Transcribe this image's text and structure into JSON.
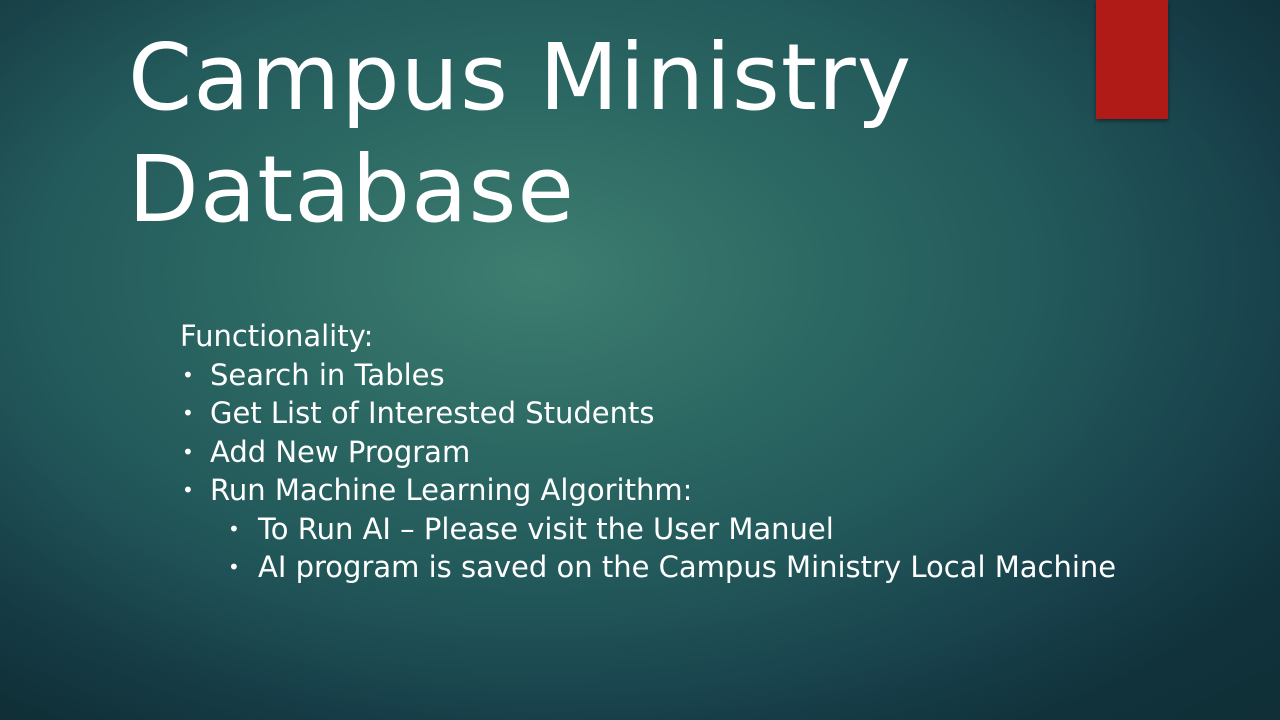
{
  "colors": {
    "accent_bar": "#b01a17",
    "text": "#ffffff"
  },
  "slide": {
    "title_lines": [
      "Campus Ministry",
      "Database"
    ],
    "heading": "Functionality:",
    "bullet_glyph": "•",
    "bullets": [
      "Search in Tables",
      "Get List of Interested Students",
      "Add New Program",
      "Run Machine Learning Algorithm:"
    ],
    "sub_bullets": [
      "To Run AI – Please visit the User Manuel",
      "AI program is saved on the Campus Ministry Local Machine"
    ]
  }
}
